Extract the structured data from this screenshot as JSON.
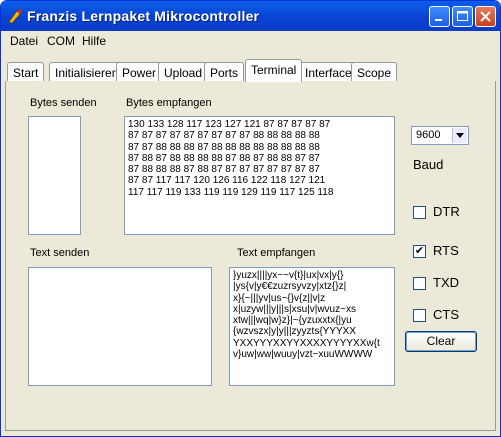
{
  "window": {
    "title": "Franzis Lernpaket Mikrocontroller"
  },
  "menu": [
    "Datei",
    "COM",
    "Hilfe"
  ],
  "tabs": [
    {
      "label": "Start"
    },
    {
      "label": "Initialisieren"
    },
    {
      "label": "Power"
    },
    {
      "label": "Upload"
    },
    {
      "label": "Ports"
    },
    {
      "label": "Terminal"
    },
    {
      "label": "Interface"
    },
    {
      "label": "Scope"
    }
  ],
  "terminal": {
    "bytes_send_label": "Bytes senden",
    "bytes_recv_label": "Bytes empfangen",
    "bytes_recv_text": "130 133 128 117 123 127 121 87 87 87 87 87\n87 87 87 87 87 87 87 87 87 88 88 88 88 88\n87 87 88 88 88 87 88 88 88 88 88 88 88 88\n87 88 87 88 88 88 88 87 88 87 88 88 87 87\n87 88 88 88 87 88 87 87 87 87 87 87 87 87\n87 87 117 117 120 126 116 122 118 127 121\n117 117 119 133 119 119 129 119 117 125 118",
    "text_send_label": "Text senden",
    "text_recv_label": "Text empfangen",
    "text_recv_text": "}yuzx||||yx~~v{t}|ux|vx|y{}\n|ys{v|y€€zuzrsyvzy|xtz{}z|\nx}{~|||yv|us~{}v{z||v|z\nx|uzyw|||y|||s|xsu|v|wvuz~xs\nxtw|||wq|w}z}|~{yzuxxtx{|yu\n{wzvszx|y|y|||zyyzts{YYYXX\nYXXYYYXXYYXXXXYYYYXXw{t\nv}uw|ww|wuuy|vzt~xuuWWWW",
    "baud_value": "9600",
    "baud_label": "Baud",
    "dtr_label": "DTR",
    "rts_label": "RTS",
    "txd_label": "TXD",
    "cts_label": "CTS",
    "rts_checked_mark": "✔",
    "clear_label": "Clear"
  }
}
